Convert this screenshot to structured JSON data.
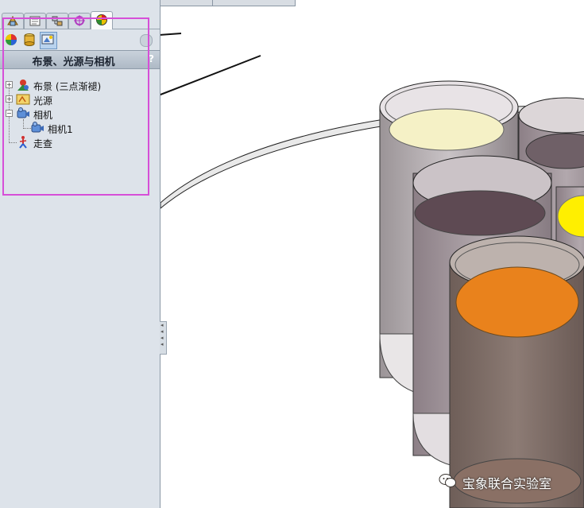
{
  "window": {
    "top_strip_tabs": [
      "",
      "",
      "",
      ""
    ]
  },
  "sidebar": {
    "tabs": [
      {
        "icon": "feature-manager-icon"
      },
      {
        "icon": "property-manager-icon"
      },
      {
        "icon": "configuration-manager-icon"
      },
      {
        "icon": "dimxpert-icon"
      },
      {
        "icon": "display-manager-icon",
        "active": true
      }
    ],
    "toolbar": [
      {
        "icon": "appearances-icon"
      },
      {
        "icon": "decals-icon"
      },
      {
        "icon": "scene-lights-cameras-icon",
        "selected": true
      }
    ],
    "panel_title": "布景、光源与相机",
    "help_label": "?",
    "tree": [
      {
        "label": "布景 (三点渐褪)",
        "icon": "scene-icon",
        "expander": "+"
      },
      {
        "label": "光源",
        "icon": "lights-icon",
        "expander": "+"
      },
      {
        "label": "相机",
        "icon": "cameras-icon",
        "expander": "−"
      },
      {
        "label": "相机1",
        "icon": "camera-icon",
        "expander": ""
      },
      {
        "label": "走查",
        "icon": "walkthrough-icon",
        "expander": ""
      }
    ]
  },
  "viewport": {
    "liquid_colors": {
      "cream": "#f5f1c6",
      "mauve": "#5e4a53",
      "orange": "#e9821c",
      "yellow": "#ffef00",
      "grey": "#7b7276"
    }
  },
  "watermark": {
    "text": "宝象联合实验室"
  },
  "colors": {
    "highlight_box": "#d64fd8",
    "sidebar_bg": "#dde3ea",
    "arrow": "#111111"
  }
}
